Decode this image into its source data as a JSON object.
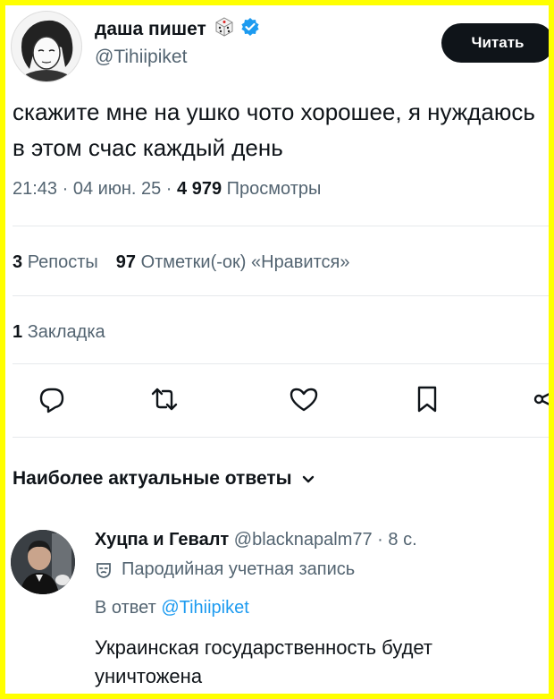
{
  "author": {
    "name": "даша пишет",
    "handle": "@Tihiipiket",
    "name_emoji": "dice-icon",
    "verified_color": "#1d9bf0"
  },
  "follow_button": {
    "label": "Читать"
  },
  "tweet": {
    "text": "скажите мне на ушко чото хорошее, я нуждаюсь в этом счас каждый день",
    "time": "21:43",
    "date": "04 июн. 25",
    "views_count": "4 979",
    "views_label": "Просмотры"
  },
  "stats": {
    "reposts_count": "3",
    "reposts_label": "Репосты",
    "likes_count": "97",
    "likes_label": "Отметки(-ок) «Нравится»",
    "bookmarks_count": "1",
    "bookmarks_label": "Закладка"
  },
  "actions": [
    {
      "icon": "reply-icon"
    },
    {
      "icon": "retweet-icon"
    },
    {
      "icon": "heart-icon"
    },
    {
      "icon": "bookmark-icon"
    },
    {
      "icon": "share-icon"
    }
  ],
  "replies_sort": {
    "label": "Наиболее актуальные ответы",
    "icon": "chevron-down-icon"
  },
  "reply": {
    "name": "Хуцпа и Гевалт",
    "handle": "@blacknapalm77",
    "time": "8 с.",
    "parody_label": "Пародийная учетная запись",
    "replying_to_prefix": "В ответ",
    "replying_to_handle": "@Tihiipiket",
    "text": "Украинская государственность будет уничтожена"
  },
  "colors": {
    "frame": "#ffff00",
    "text_primary": "#0f1419",
    "text_secondary": "#536471",
    "link": "#1d9bf0",
    "button_bg": "#0f1419"
  }
}
